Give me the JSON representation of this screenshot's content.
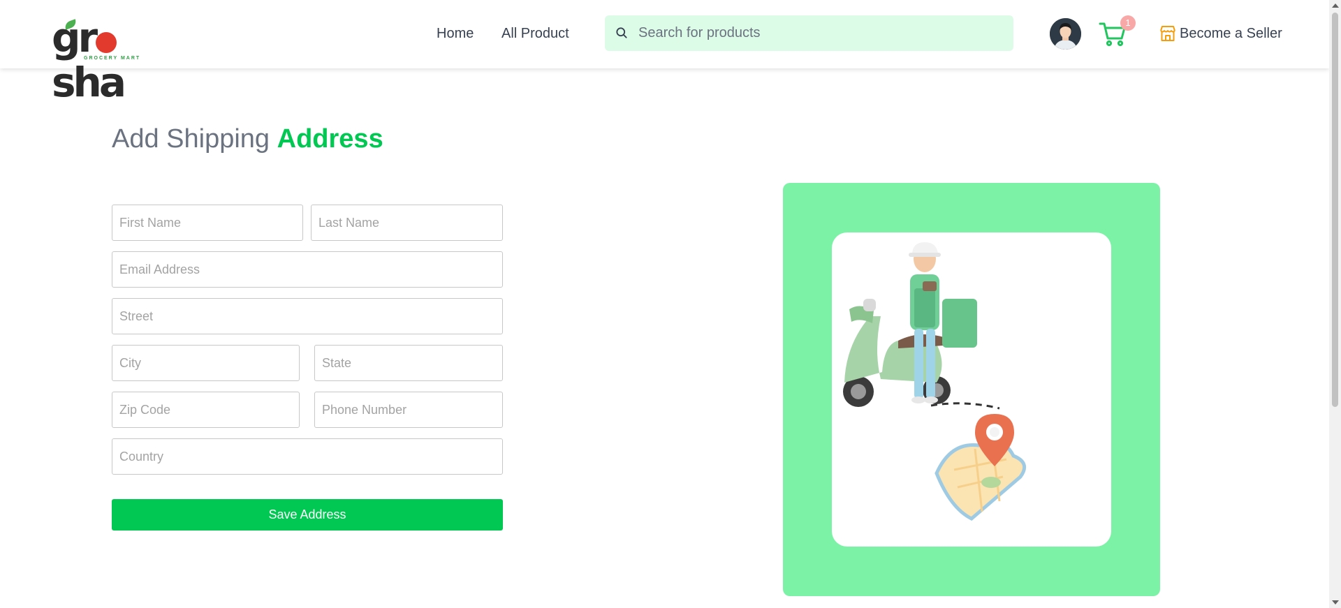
{
  "brand": {
    "name": "grosha",
    "tagline": "GROCERY MART"
  },
  "nav": {
    "home": "Home",
    "all_product": "All Product"
  },
  "search": {
    "placeholder": "Search for products",
    "value": ""
  },
  "cart": {
    "count": "1"
  },
  "seller_link": "Become a Seller",
  "page": {
    "title_plain": "Add Shipping",
    "title_accent": "Address"
  },
  "form": {
    "first_name": {
      "placeholder": "First Name",
      "value": ""
    },
    "last_name": {
      "placeholder": "Last Name",
      "value": ""
    },
    "email": {
      "placeholder": "Email Address",
      "value": ""
    },
    "street": {
      "placeholder": "Street",
      "value": ""
    },
    "city": {
      "placeholder": "City",
      "value": ""
    },
    "state": {
      "placeholder": "State",
      "value": ""
    },
    "zip": {
      "placeholder": "Zip Code",
      "value": ""
    },
    "phone": {
      "placeholder": "Phone Number",
      "value": ""
    },
    "country": {
      "placeholder": "Country",
      "value": ""
    },
    "submit_label": "Save Address"
  },
  "icons": {
    "search": "search-icon",
    "cart": "shopping-cart-icon",
    "store": "store-icon",
    "avatar": "user-avatar"
  },
  "colors": {
    "accent": "#00c853",
    "search_bg": "#dcfce7",
    "illustration_bg": "#7cf2a6",
    "badge": "#f9a8a8",
    "store_icon": "#f59e0b"
  }
}
